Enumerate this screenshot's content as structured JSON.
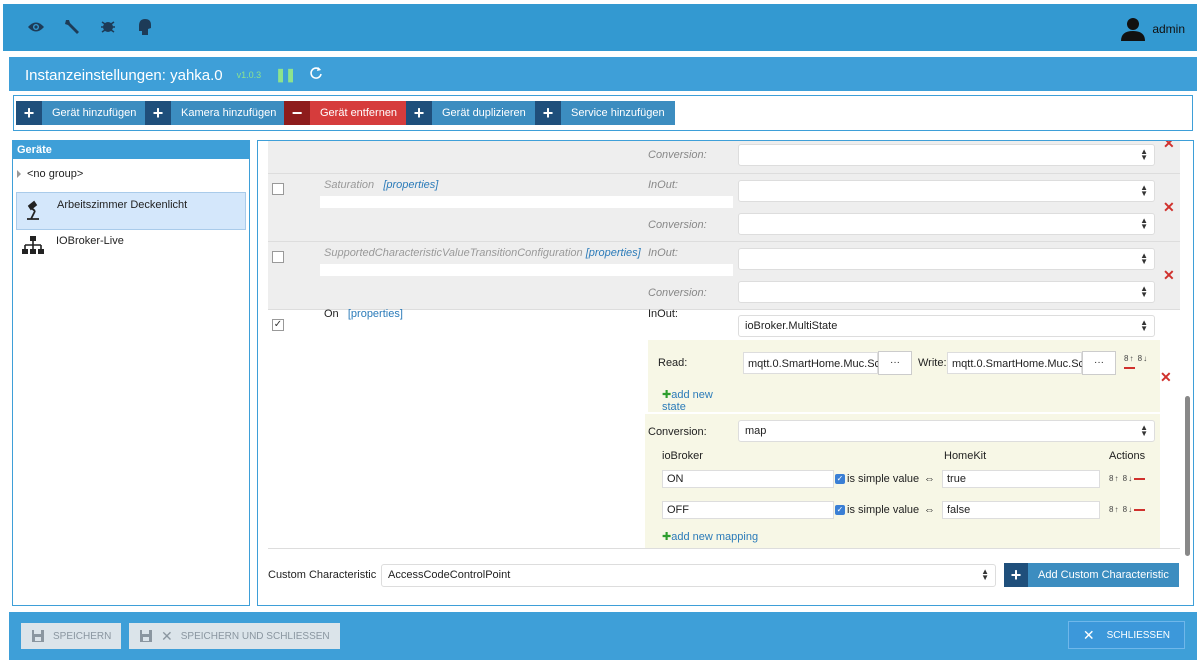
{
  "topbar": {
    "icons": [
      "eye-icon",
      "wrench-icon",
      "bug-icon",
      "head-icon"
    ],
    "user": "admin"
  },
  "dialog": {
    "title": "Instanzeinstellungen: yahka.0",
    "version": "v1.0.3"
  },
  "toolbar": {
    "buttons": [
      {
        "label": "Gerät hinzufügen"
      },
      {
        "label": "Kamera hinzufügen"
      },
      {
        "label": "Gerät entfernen"
      },
      {
        "label": "Gerät duplizieren"
      },
      {
        "label": "Service hinzufügen"
      }
    ]
  },
  "left": {
    "header": "Geräte",
    "group": "<no group>",
    "devices": [
      {
        "label": "Arbeitszimmer Deckenlicht",
        "icon": "desk-lamp-icon",
        "selected": true
      },
      {
        "label": "IOBroker-Live",
        "icon": "network-icon",
        "selected": false
      }
    ]
  },
  "chars": {
    "conversion_label": "Conversion:",
    "inout_label": "InOut:",
    "props_label": "[properties]",
    "saturation": "Saturation",
    "supported": "SupportedCharacteristicValueTransitionConfiguration",
    "on": "On",
    "on_inout_value": "ioBroker.MultiState",
    "read_label": "Read:",
    "read_value": "mqtt.0.SmartHome.Muc.Sc",
    "write_label": "Write:",
    "write_value": "mqtt.0.SmartHome.Muc.Sc",
    "dots": "···",
    "add_state_line1": "add new",
    "add_state_line2": "state",
    "conversion_value": "map",
    "map_headers": {
      "iobroker": "ioBroker",
      "homekit": "HomeKit",
      "actions": "Actions"
    },
    "mappings": [
      {
        "iobroker": "ON",
        "simple": "is simple value",
        "arrow": "⇔",
        "homekit": "true"
      },
      {
        "iobroker": "OFF",
        "simple": "is simple value",
        "arrow": "⇔",
        "homekit": "false"
      }
    ],
    "add_mapping": "add new mapping",
    "order_icons": "8↑ 8↓"
  },
  "custom": {
    "label": "Custom Characteristic",
    "value": "AccessCodeControlPoint",
    "button": "Add Custom Characteristic"
  },
  "footer": {
    "save": "Speichern",
    "save_close": "Speichern und schliessen",
    "close": "Schliessen"
  }
}
